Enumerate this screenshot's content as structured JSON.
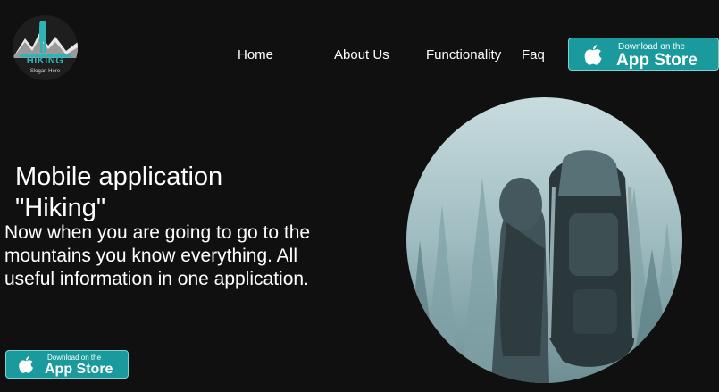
{
  "logo": {
    "brand": "HIKING",
    "slogan": "Slogan Here",
    "icon": "hiker-mountain-logo"
  },
  "nav": {
    "items": [
      {
        "label": "Home"
      },
      {
        "label": "About Us"
      },
      {
        "label": "Functionality"
      },
      {
        "label": "Faq"
      }
    ]
  },
  "store_button": {
    "small": "Download on the",
    "big": "App Store",
    "icon": "apple-icon"
  },
  "hero": {
    "title_line1": "Mobile application",
    "title_line2": "\"Hiking\"",
    "description": "Now when you are going to go to the mountains you know everything. All useful information in one application.",
    "image": "hiker-with-backpack-in-foggy-forest"
  },
  "colors": {
    "background": "#101010",
    "accent": "#1a9a9c",
    "text": "#ffffff"
  }
}
